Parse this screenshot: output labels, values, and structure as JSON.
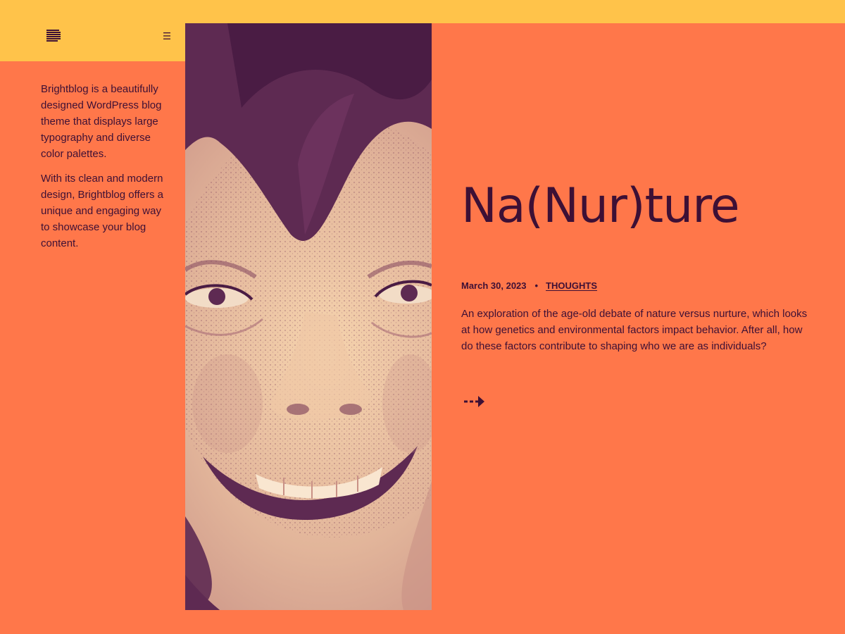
{
  "colors": {
    "header_yellow": "#FFC34A",
    "background_orange": "#FF774A",
    "text_plum": "#3D1035",
    "image_highlight": "#F6D4AE"
  },
  "header": {
    "logo_icon": "lines-logo-icon",
    "menu_icon": "hamburger-menu-icon"
  },
  "sidebar": {
    "paragraphs": [
      "Brightblog is a beautifully designed WordPress blog theme that displays large typography and diverse color palettes.",
      "With its clean and modern design, Brightblog offers a unique and engaging way to showcase your blog content."
    ]
  },
  "post": {
    "title": "Na(Nur)ture",
    "date": "March 30, 2023",
    "separator": "•",
    "category": "THOUGHTS",
    "excerpt": "An exploration of the age-old debate of nature versus nurture, which looks at how genetics and environmental factors impact behavior. After all, how do these factors contribute to shaping who we are as individuals?",
    "read_more_icon": "dashed-arrow-right-icon",
    "image_subject": "smiling-child-portrait"
  }
}
